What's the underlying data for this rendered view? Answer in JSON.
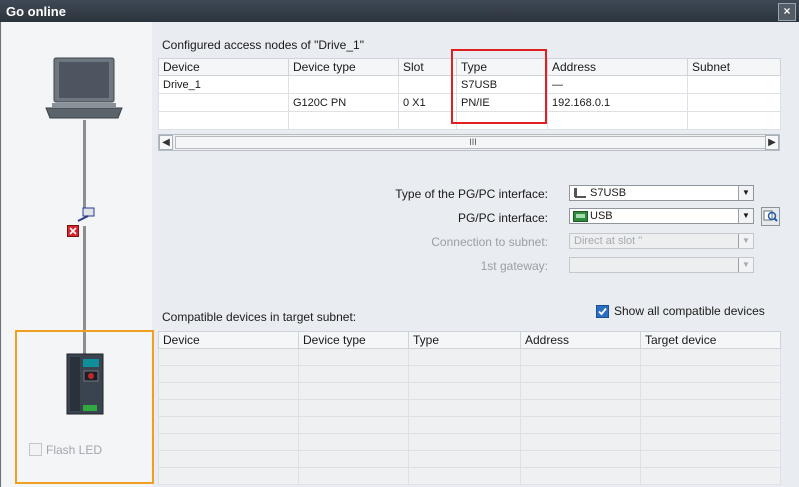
{
  "window": {
    "title": "Go online",
    "close_glyph": "×"
  },
  "configured": {
    "title": "Configured access nodes of \"Drive_1\"",
    "columns": [
      "Device",
      "Device type",
      "Slot",
      "Type",
      "Address",
      "Subnet"
    ],
    "rows": [
      [
        "Drive_1",
        "",
        "",
        "S7USB",
        "—",
        ""
      ],
      [
        "",
        "G120C PN",
        "0 X1",
        "PN/IE",
        "192.168.0.1",
        ""
      ],
      [
        "",
        "",
        "",
        "",
        "",
        ""
      ]
    ],
    "scroll_grip": "III"
  },
  "interface": {
    "type_label": "Type of the PG/PC interface:",
    "type_value": "S7USB",
    "pgpc_label": "PG/PC interface:",
    "pgpc_value": "USB",
    "subnet_label": "Connection to subnet:",
    "subnet_value": "Direct at slot ''",
    "gateway_label": "1st gateway:",
    "gateway_value": ""
  },
  "compatible": {
    "title": "Compatible devices in target subnet:",
    "show_all_label": "Show all compatible devices",
    "show_all_checked": true,
    "columns": [
      "Device",
      "Device type",
      "Type",
      "Address",
      "Target device"
    ]
  },
  "left": {
    "flash_led_label": "Flash LED"
  },
  "icons": [
    "laptop-icon",
    "network-switch-icon",
    "connection-error-icon",
    "drive-device-icon",
    "search-device-icon"
  ],
  "colors": {
    "highlight_red": "#e02020",
    "highlight_orange": "#f0a020",
    "title_bar": "#2c343d"
  }
}
